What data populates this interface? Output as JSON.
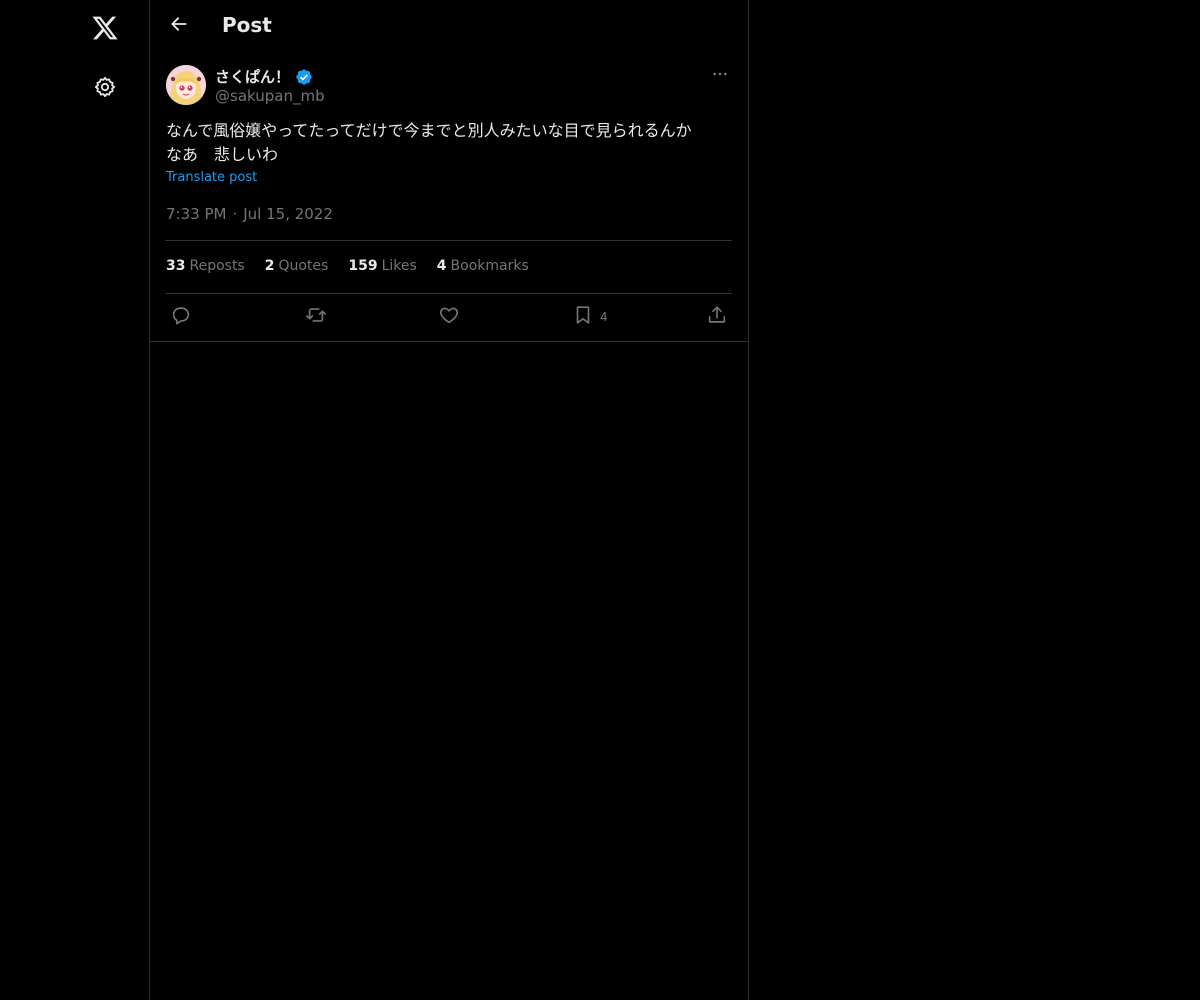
{
  "nav": {
    "logo_icon": "x-logo-icon",
    "settings_icon": "gear-icon"
  },
  "header": {
    "back_icon": "arrow-left-icon",
    "title": "Post"
  },
  "post": {
    "author": {
      "display_name": "さくぱん！",
      "verified": true,
      "handle": "@sakupan_mb"
    },
    "text": "なんで風俗嬢やってたってだけで今までと別人みたいな目で見られるんか\nなあ　悲しいわ",
    "translate_label": "Translate post",
    "time": "7:33 PM",
    "separator": "·",
    "date": "Jul 15, 2022",
    "stats": [
      {
        "count": "33",
        "label": "Reposts"
      },
      {
        "count": "2",
        "label": "Quotes"
      },
      {
        "count": "159",
        "label": "Likes"
      },
      {
        "count": "4",
        "label": "Bookmarks"
      }
    ],
    "actions": {
      "reply_icon": "reply-icon",
      "repost_icon": "repost-icon",
      "like_icon": "heart-icon",
      "bookmark_icon": "bookmark-icon",
      "bookmark_count": "4",
      "share_icon": "share-icon"
    }
  },
  "colors": {
    "background": "#000000",
    "text_primary": "#e7e9ea",
    "text_secondary": "#71767b",
    "accent": "#1d9bf0",
    "border": "#2f3336"
  }
}
